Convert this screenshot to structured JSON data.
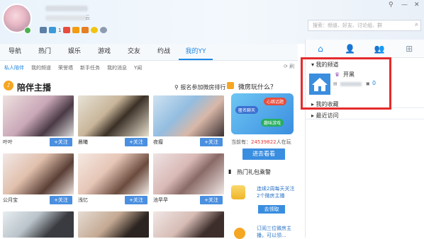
{
  "profile": {
    "sub_tail": "云",
    "badge_count": "1",
    "icons": [
      "gamepad-icon",
      "vip-icon",
      "nine-icon",
      "yy-icon",
      "hat-icon",
      "face-icon",
      "eye-icon"
    ]
  },
  "window": {
    "pin": "⚲",
    "minimize": "—",
    "close": "✕"
  },
  "search": {
    "placeholder": "搜索：频道、好友、讨论组、群"
  },
  "nav": {
    "items": [
      "导航",
      "热门",
      "娱乐",
      "游戏",
      "交友",
      "约战",
      "我的YY"
    ],
    "active": 6
  },
  "subnav": {
    "items": [
      "私人陪伴",
      "我的频道",
      "荣誉墙",
      "新手任务",
      "我的消息",
      "Y闻"
    ],
    "active": 0,
    "refresh": "⟳ 刷"
  },
  "section": {
    "title": "陪伴主播",
    "rank_link": "报名参加微房排行"
  },
  "follow_label": "+关注",
  "streamers": [
    {
      "name": "叶叶"
    },
    {
      "name": "晨曦"
    },
    {
      "name": "夜瘤"
    },
    {
      "name": "公月宝"
    },
    {
      "name": "浅忆"
    },
    {
      "name": "池早早"
    },
    {
      "name": "",
      "partial": true
    },
    {
      "name": "",
      "partial": true
    },
    {
      "name": "",
      "partial": true
    }
  ],
  "weifang": {
    "title": "微房玩什么？",
    "bubbles": [
      "匿名聊天",
      "心跳话题",
      "趣味游戏"
    ],
    "online_prefix": "当前有：",
    "online_num": "24539822",
    "online_suffix": "人在玩",
    "enter_btn": "进去看看"
  },
  "gift": {
    "title": "热门礼包乘警",
    "text1": "连续2周每天关注2个微房主播",
    "btn1": "去领取",
    "text2": "订阅三位微房主播，可以领..."
  },
  "sidebar": {
    "tabs": [
      "⌂",
      "👤",
      "👥",
      "⊞"
    ],
    "active": 0,
    "my_channel": "▾ 我的频道",
    "channel_name": "开黑",
    "channel_count": "0",
    "favorites": "▸ 我的收藏",
    "recent": "▸ 最近访问"
  },
  "colors": {
    "accent": "#1e88e5",
    "highlight_box": "#e52b2b"
  }
}
